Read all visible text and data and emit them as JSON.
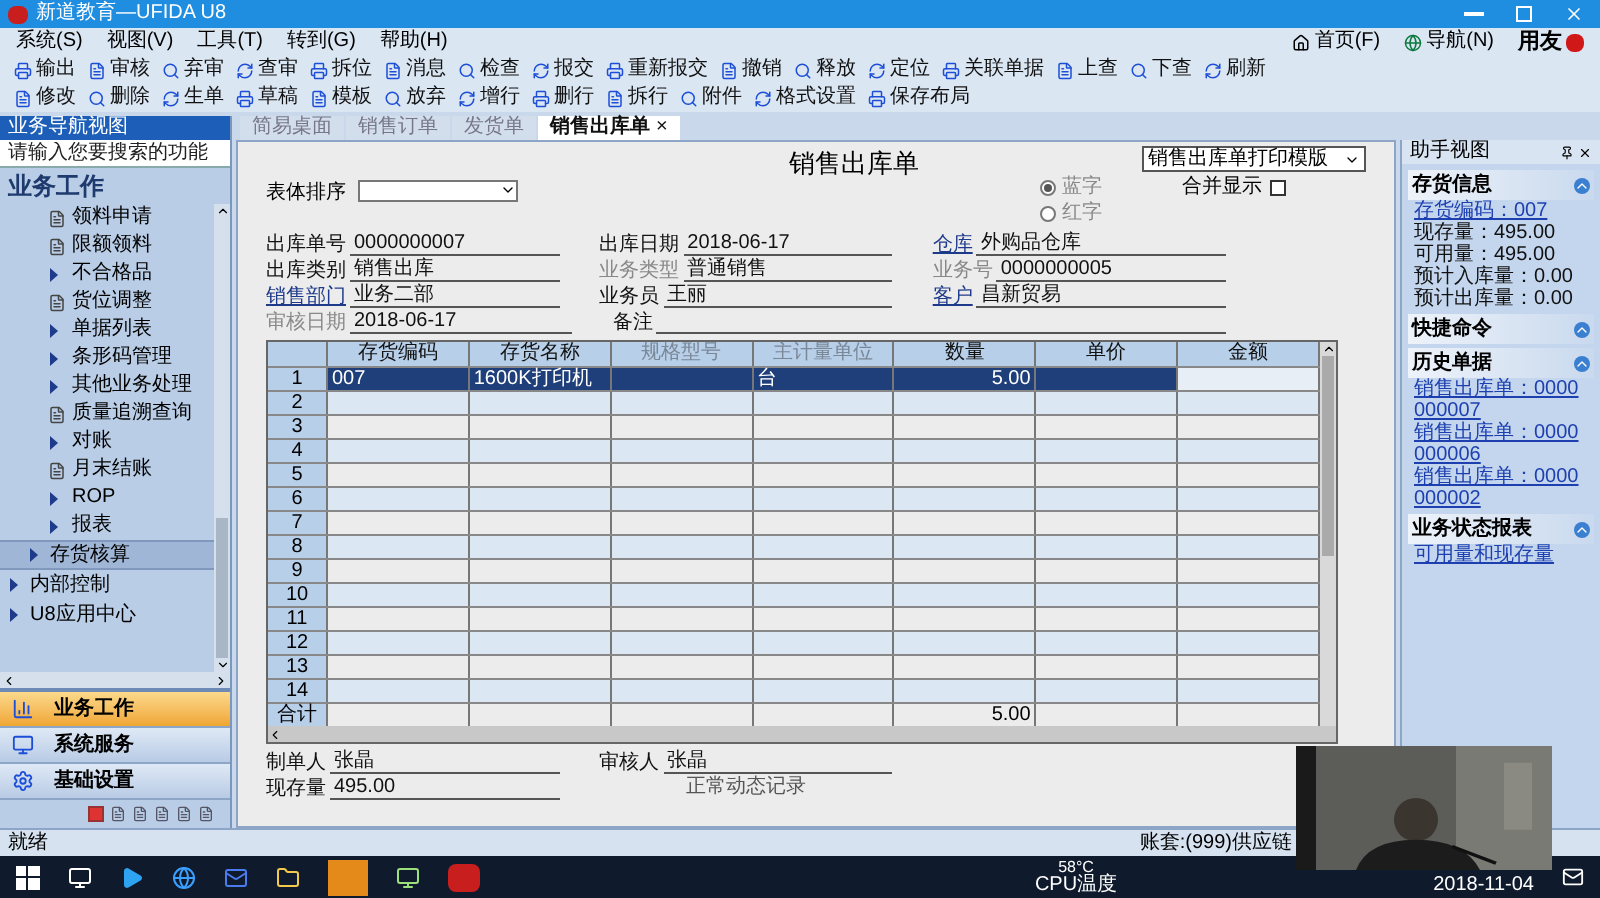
{
  "window": {
    "title": "新道教育—UFIDA U8"
  },
  "menu": [
    "系统(S)",
    "视图(V)",
    "工具(T)",
    "转到(G)",
    "帮助(H)"
  ],
  "top_links": [
    "首页(F)",
    "导航(N)"
  ],
  "brand": "用友",
  "toolbar_1": [
    "输出",
    "审核",
    "弃审",
    "查审",
    "拆位",
    "消息",
    "检查",
    "报交",
    "重新报交",
    "撤销",
    "释放",
    "定位",
    "关联单据",
    "上查",
    "下查",
    "刷新"
  ],
  "toolbar_2": [
    "修改",
    "删除",
    "生单",
    "草稿",
    "模板",
    "放弃",
    "增行",
    "删行",
    "拆行",
    "附件",
    "格式设置",
    "保存布局"
  ],
  "sidebar": {
    "title": "业务导航视图",
    "search": {
      "placeholder": "请输入您要搜索的功能"
    },
    "heading": "业务工作",
    "items": [
      {
        "label": "领料申请",
        "kind": "doc"
      },
      {
        "label": "限额领料",
        "kind": "doc"
      },
      {
        "label": "不合格品",
        "kind": "group"
      },
      {
        "label": "货位调整",
        "kind": "doc"
      },
      {
        "label": "单据列表",
        "kind": "group"
      },
      {
        "label": "条形码管理",
        "kind": "group"
      },
      {
        "label": "其他业务处理",
        "kind": "group"
      },
      {
        "label": "质量追溯查询",
        "kind": "doc"
      },
      {
        "label": "对账",
        "kind": "group"
      },
      {
        "label": "月末结账",
        "kind": "doc"
      },
      {
        "label": "ROP",
        "kind": "group"
      },
      {
        "label": "报表",
        "kind": "group"
      }
    ],
    "modules": [
      {
        "label": "存货核算",
        "selected": true
      }
    ],
    "roots": [
      {
        "label": "内部控制"
      },
      {
        "label": "U8应用中心"
      }
    ],
    "nav": [
      {
        "label": "业务工作",
        "selected": true
      },
      {
        "label": "系统服务",
        "selected": false
      },
      {
        "label": "基础设置",
        "selected": false
      }
    ]
  },
  "tabs": [
    {
      "label": "简易桌面",
      "selected": false
    },
    {
      "label": "销售订单",
      "selected": false
    },
    {
      "label": "发货单",
      "selected": false
    },
    {
      "label": "销售出库单",
      "selected": true,
      "close": "×"
    }
  ],
  "form": {
    "title": "销售出库单",
    "template": "销售出库单打印模版",
    "sort": {
      "label": "表体排序"
    },
    "radios": [
      {
        "label": "蓝字",
        "selected": true
      },
      {
        "label": "红字",
        "selected": false
      }
    ],
    "merge": {
      "label": "合并显示",
      "checked": false
    },
    "fields": [
      [
        {
          "label": "出库单号",
          "value": "0000000007",
          "kind": "plain"
        },
        {
          "label": "出库日期",
          "value": "2018-06-17",
          "kind": "plain"
        },
        {
          "label": "仓库",
          "value": "外购品仓库",
          "kind": "link"
        }
      ],
      [
        {
          "label": "出库类别",
          "value": "销售出库",
          "kind": "plain"
        },
        {
          "label": "业务类型",
          "value": "普通销售",
          "kind": "disabled"
        },
        {
          "label": "业务号",
          "value": "0000000005",
          "kind": "disabled"
        }
      ],
      [
        {
          "label": "销售部门",
          "value": "业务二部",
          "kind": "link"
        },
        {
          "label": "业务员",
          "value": "王丽",
          "kind": "plain"
        },
        {
          "label": "客户",
          "value": "昌新贸易",
          "kind": "link"
        }
      ],
      [
        {
          "label": "审核日期",
          "value": "2018-06-17",
          "kind": "disabled"
        },
        {
          "label": "备注",
          "kind": "plain"
        }
      ]
    ],
    "table": {
      "columns": [
        {
          "label": "存货编码",
          "disabled": false
        },
        {
          "label": "存货名称",
          "disabled": false
        },
        {
          "label": "规格型号",
          "disabled": true
        },
        {
          "label": "主计量单位",
          "disabled": true
        },
        {
          "label": "数量",
          "disabled": false
        },
        {
          "label": "单价",
          "disabled": false
        },
        {
          "label": "金额",
          "disabled": false
        }
      ],
      "rows": [
        {
          "number": "1",
          "selected": true,
          "cells": [
            "007",
            "1600K打印机",
            null,
            "台",
            "5.00",
            null,
            null
          ]
        },
        {
          "number": "2",
          "selected": false
        },
        {
          "number": "3",
          "selected": false
        },
        {
          "number": "4",
          "selected": false
        },
        {
          "number": "5",
          "selected": false
        },
        {
          "number": "6",
          "selected": false
        },
        {
          "number": "7",
          "selected": false
        },
        {
          "number": "8",
          "selected": false
        },
        {
          "number": "9",
          "selected": false
        },
        {
          "number": "10",
          "selected": false
        },
        {
          "number": "11",
          "selected": false
        },
        {
          "number": "12",
          "selected": false
        },
        {
          "number": "13",
          "selected": false
        },
        {
          "number": "14",
          "selected": false
        }
      ],
      "total": {
        "label": "合计",
        "quantity": "5.00"
      }
    },
    "footer": [
      {
        "label": "制单人",
        "value": "张晶"
      },
      {
        "label": "审核人",
        "value": "张晶"
      },
      {
        "label": "现存量",
        "value": "495.00"
      }
    ],
    "dynamic_record": "正常动态记录"
  },
  "assistant": {
    "title": "助手视图",
    "sections": [
      {
        "title": "存货信息",
        "items": [
          {
            "text": "存货编码：007",
            "kind": "link"
          },
          {
            "text": "现存量：495.00",
            "kind": "text"
          },
          {
            "text": "可用量：495.00",
            "kind": "text"
          },
          {
            "text": "预计入库量：0.00",
            "kind": "text"
          },
          {
            "text": "预计出库量：0.00",
            "kind": "text"
          }
        ]
      },
      {
        "title": "快捷命令"
      },
      {
        "title": "历史单据",
        "items": [
          {
            "text": "销售出库单：0000000007",
            "kind": "link"
          },
          {
            "text": "销售出库单：0000000006",
            "kind": "link"
          },
          {
            "text": "销售出库单：0000000002",
            "kind": "link"
          }
        ]
      },
      {
        "title": "业务状态报表",
        "items": [
          {
            "text": "可用量和现存量",
            "kind": "link"
          }
        ]
      }
    ]
  },
  "status_bar": {
    "text": "就绪",
    "account": "账套:(999)供应链"
  },
  "taskbar": {
    "temperature": "58°C",
    "temperature_label": "CPU温度",
    "date": "2018-11-04"
  },
  "webcam": {
    "kind": "picture"
  }
}
